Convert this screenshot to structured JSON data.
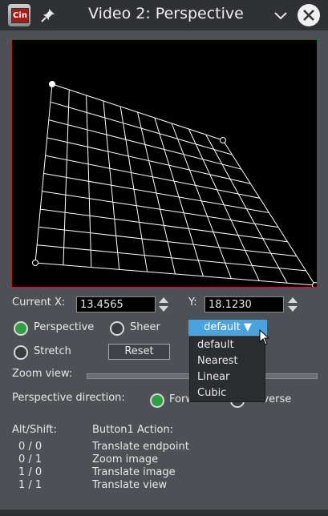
{
  "window": {
    "title": "Video 2: Perspective",
    "app_icon_text": "Cin"
  },
  "current_x": {
    "label": "Current X:",
    "value": "13.4565"
  },
  "y_field": {
    "label": "Y:",
    "value": "18.1230"
  },
  "mode": {
    "perspective_label": "Perspective",
    "sheer_label": "Sheer",
    "stretch_label": "Stretch",
    "selected": "Perspective"
  },
  "interpolation": {
    "selected_label": "default ▼",
    "options": [
      "default",
      "Nearest",
      "Linear",
      "Cubic"
    ]
  },
  "reset_label": "Reset",
  "zoom_view_label": "Zoom view:",
  "direction": {
    "label": "Perspective direction:",
    "forward_label": "Forward",
    "reverse_label": "Reverse",
    "selected": "Forward"
  },
  "help": {
    "col1_header": "Alt/Shift:",
    "col2_header": "Button1 Action:",
    "rows": [
      {
        "keys": "0 / 0",
        "action": "Translate endpoint"
      },
      {
        "keys": "0 / 1",
        "action": "Zoom image"
      },
      {
        "keys": "1 / 0",
        "action": "Translate image"
      },
      {
        "keys": "1 / 1",
        "action": "Translate view"
      }
    ]
  },
  "colors": {
    "accent": "#4aa3df",
    "radio_on": "#2ea043",
    "canvas_border": "#b22222"
  },
  "icons": [
    "app-icon",
    "pin-icon",
    "chevron-down-icon",
    "close-icon"
  ]
}
